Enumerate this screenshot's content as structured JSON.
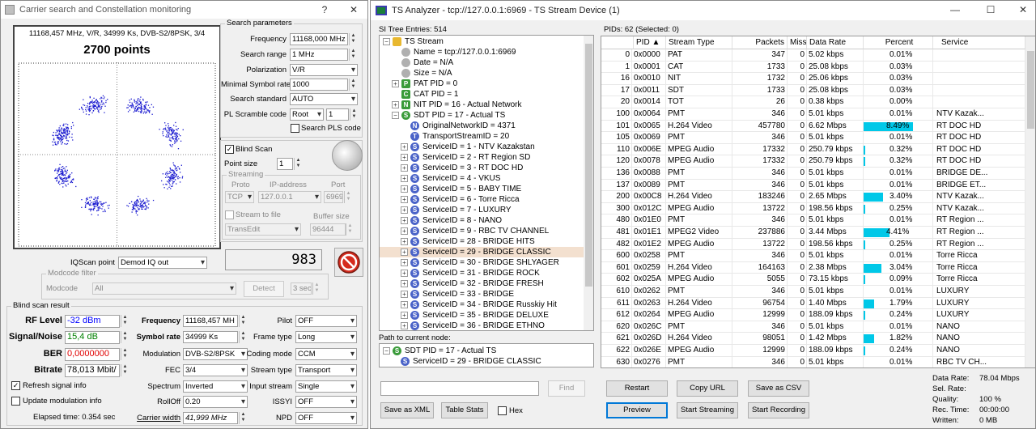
{
  "left_window": {
    "title": "Carrier search and Constellation monitoring",
    "help": "?",
    "close": "✕",
    "constellation": {
      "header": "11168,457 MHz, V/R, 34999 Ks, DVB-S2/8PSK, 3/4",
      "points_label": "2700 points"
    },
    "search_params": {
      "title": "Search parameters",
      "frequency_label": "Frequency",
      "frequency": "11168,000 MHz",
      "search_range_label": "Search range",
      "search_range": "1 MHz",
      "polarization_label": "Polarization",
      "polarization": "V/R",
      "min_sr_label": "Minimal Symbol rate",
      "min_sr": "1000",
      "standard_label": "Search standard",
      "standard": "AUTO",
      "pls_label": "PL Scramble code",
      "pls_mode": "Root",
      "pls_value": "1",
      "search_pls_label": "Search PLS code"
    },
    "blind": {
      "blind_scan_label": "Blind Scan",
      "point_size_label": "Point size",
      "point_size": "1"
    },
    "streaming": {
      "title": "Streaming",
      "proto_label": "Proto",
      "proto": "TCP",
      "ip_label": "IP-address",
      "ip": "127.0.0.1",
      "port_label": "Port",
      "port": "6969",
      "stream_to_file_label": "Stream to file",
      "buffer_label": "Buffer size",
      "file": "TransEdit",
      "buffer": "96444"
    },
    "counter": "983",
    "iqscan_label": "IQScan point",
    "iqscan": "Demod IQ out",
    "modcode_filter": {
      "title": "Modcode filter",
      "modcode_label": "Modcode",
      "modcode": "All",
      "detect": "Detect",
      "interval": "3 sec"
    },
    "result": {
      "title": "Blind scan result",
      "rf_label": "RF Level",
      "rf": "-32 dBm",
      "sn_label": "Signal/Noise",
      "sn": "15,4 dB",
      "ber_label": "BER",
      "ber": "0,0000000",
      "bitrate_label": "Bitrate",
      "bitrate": "78,013 Mbit/",
      "freq_label": "Frequency",
      "freq": "11168,457 MH",
      "sr_label": "Symbol rate",
      "sr": "34999 Ks",
      "mod_label": "Modulation",
      "mod": "DVB-S2/8PSK",
      "fec_label": "FEC",
      "fec": "3/4",
      "spectrum_label": "Spectrum",
      "spectrum": "Inverted",
      "rolloff_label": "RollOff",
      "rolloff": "0.20",
      "cw_label": "Carrier width",
      "cw": "41,999 MHz",
      "pilot_label": "Pilot",
      "pilot": "OFF",
      "frame_label": "Frame type",
      "frame": "Long",
      "coding_label": "Coding mode",
      "coding": "CCM",
      "stype_label": "Stream type",
      "stype": "Transport",
      "input_label": "Input stream",
      "input": "Single",
      "issyi_label": "ISSYI",
      "issyi": "OFF",
      "npd_label": "NPD",
      "npd": "OFF",
      "refresh_label": "Refresh signal info",
      "update_label": "Update modulation info",
      "elapsed": "Elapsed time: 0.354 sec"
    }
  },
  "ts_window": {
    "title": "TS Analyzer - tcp://127.0.0.1:6969 - TS Stream Device (1)",
    "min": "—",
    "max": "☐",
    "close": "✕",
    "tree_header": "SI Tree Entries: 514",
    "tree": [
      {
        "text": "TS Stream",
        "lvl": 0,
        "ico": "folder",
        "exp": "−"
      },
      {
        "text": "Name = tcp://127.0.0.1:6969",
        "lvl": 1,
        "ico": "dot"
      },
      {
        "text": "Date = N/A",
        "lvl": 1,
        "ico": "dot"
      },
      {
        "text": "Size = N/A",
        "lvl": 1,
        "ico": "dot"
      },
      {
        "text": "PAT PID = 0",
        "lvl": 1,
        "ico": "P",
        "exp": "+"
      },
      {
        "text": "CAT PID = 1",
        "lvl": 1,
        "ico": "C"
      },
      {
        "text": "NIT PID = 16 - Actual Network",
        "lvl": 1,
        "ico": "N",
        "exp": "+"
      },
      {
        "text": "SDT PID = 17 - Actual TS",
        "lvl": 1,
        "ico": "S",
        "exp": "−"
      },
      {
        "text": "OriginalNetworkID = 4371",
        "lvl": 2,
        "ico": "N2"
      },
      {
        "text": "TransportStreamID = 20",
        "lvl": 2,
        "ico": "T"
      },
      {
        "text": "ServiceID = 1 - NTV Kazakstan",
        "lvl": 2,
        "ico": "S2",
        "exp": "+"
      },
      {
        "text": "ServiceID = 2 - RT Region SD",
        "lvl": 2,
        "ico": "S2",
        "exp": "+"
      },
      {
        "text": "ServiceID = 3 - RT DOC HD",
        "lvl": 2,
        "ico": "S2",
        "exp": "+"
      },
      {
        "text": "ServiceID = 4 - VKUS",
        "lvl": 2,
        "ico": "S2",
        "exp": "+"
      },
      {
        "text": "ServiceID = 5 - BABY TIME",
        "lvl": 2,
        "ico": "S2",
        "exp": "+"
      },
      {
        "text": "ServiceID = 6 - Torre Ricca",
        "lvl": 2,
        "ico": "S2",
        "exp": "+"
      },
      {
        "text": "ServiceID = 7 - LUXURY",
        "lvl": 2,
        "ico": "S2",
        "exp": "+"
      },
      {
        "text": "ServiceID = 8 - NANO",
        "lvl": 2,
        "ico": "S2",
        "exp": "+"
      },
      {
        "text": "ServiceID = 9 - RBC TV CHANNEL",
        "lvl": 2,
        "ico": "S2",
        "exp": "+"
      },
      {
        "text": "ServiceID = 28 - BRIDGE HITS",
        "lvl": 2,
        "ico": "S2",
        "exp": "+"
      },
      {
        "text": "ServiceID = 29 - BRIDGE CLASSIC",
        "lvl": 2,
        "ico": "S2",
        "exp": "+",
        "sel": true
      },
      {
        "text": "ServiceID = 30 - BRIDGE SHLYAGER",
        "lvl": 2,
        "ico": "S2",
        "exp": "+"
      },
      {
        "text": "ServiceID = 31 - BRIDGE ROCK",
        "lvl": 2,
        "ico": "S2",
        "exp": "+"
      },
      {
        "text": "ServiceID = 32 - BRIDGE FRESH",
        "lvl": 2,
        "ico": "S2",
        "exp": "+"
      },
      {
        "text": "ServiceID = 33 - BRIDGE",
        "lvl": 2,
        "ico": "S2",
        "exp": "+"
      },
      {
        "text": "ServiceID = 34 - BRIDGE Russkiy Hit",
        "lvl": 2,
        "ico": "S2",
        "exp": "+"
      },
      {
        "text": "ServiceID = 35 - BRIDGE DELUXE",
        "lvl": 2,
        "ico": "S2",
        "exp": "+"
      },
      {
        "text": "ServiceID = 36 - BRIDGE ETHNO",
        "lvl": 2,
        "ico": "S2",
        "exp": "+"
      }
    ],
    "path_label": "Path to current node:",
    "path": [
      "SDT PID = 17 - Actual TS",
      "ServiceID = 29 - BRIDGE CLASSIC"
    ],
    "find": "Find",
    "save_xml": "Save as XML",
    "table_stats": "Table Stats",
    "hex": "Hex",
    "pids_header": "PIDs: 62  (Selected: 0)",
    "columns": [
      "PID",
      "Stream Type",
      "Packets",
      "Missi...",
      "Data Rate",
      "Percent",
      "Service"
    ],
    "rows": [
      [
        "0",
        "0x0000",
        "PAT",
        "347",
        "0",
        "5.02 kbps",
        "0.01%",
        "",
        0
      ],
      [
        "1",
        "0x0001",
        "CAT",
        "1733",
        "0",
        "25.08 kbps",
        "0.03%",
        "",
        0
      ],
      [
        "16",
        "0x0010",
        "NIT",
        "1732",
        "0",
        "25.06 kbps",
        "0.03%",
        "",
        0
      ],
      [
        "17",
        "0x0011",
        "SDT",
        "1733",
        "0",
        "25.08 kbps",
        "0.03%",
        "",
        0
      ],
      [
        "20",
        "0x0014",
        "TOT",
        "26",
        "0",
        "0.38 kbps",
        "0.00%",
        "",
        0
      ],
      [
        "100",
        "0x0064",
        "PMT",
        "346",
        "0",
        "5.01 kbps",
        "0.01%",
        "NTV Kazak...",
        0
      ],
      [
        "101",
        "0x0065",
        "H.264 Video",
        "457780",
        "0",
        "6.62 Mbps",
        "8.49%",
        "RT DOC HD",
        8.49
      ],
      [
        "105",
        "0x0069",
        "PMT",
        "346",
        "0",
        "5.01 kbps",
        "0.01%",
        "RT DOC HD",
        0
      ],
      [
        "110",
        "0x006E",
        "MPEG Audio",
        "17332",
        "0",
        "250.79 kbps",
        "0.32%",
        "RT DOC HD",
        0.32
      ],
      [
        "120",
        "0x0078",
        "MPEG Audio",
        "17332",
        "0",
        "250.79 kbps",
        "0.32%",
        "RT DOC HD",
        0.32
      ],
      [
        "136",
        "0x0088",
        "PMT",
        "346",
        "0",
        "5.01 kbps",
        "0.01%",
        "BRIDGE DE...",
        0
      ],
      [
        "137",
        "0x0089",
        "PMT",
        "346",
        "0",
        "5.01 kbps",
        "0.01%",
        "BRIDGE ET...",
        0
      ],
      [
        "200",
        "0x00C8",
        "H.264 Video",
        "183246",
        "0",
        "2.65 Mbps",
        "3.40%",
        "NTV Kazak...",
        3.4
      ],
      [
        "300",
        "0x012C",
        "MPEG Audio",
        "13722",
        "0",
        "198.56 kbps",
        "0.25%",
        "NTV Kazak...",
        0.25
      ],
      [
        "480",
        "0x01E0",
        "PMT",
        "346",
        "0",
        "5.01 kbps",
        "0.01%",
        "RT Region ...",
        0
      ],
      [
        "481",
        "0x01E1",
        "MPEG2 Video",
        "237886",
        "0",
        "3.44 Mbps",
        "4.41%",
        "RT Region ...",
        4.41
      ],
      [
        "482",
        "0x01E2",
        "MPEG Audio",
        "13722",
        "0",
        "198.56 kbps",
        "0.25%",
        "RT Region ...",
        0.25
      ],
      [
        "600",
        "0x0258",
        "PMT",
        "346",
        "0",
        "5.01 kbps",
        "0.01%",
        "Torre Ricca",
        0
      ],
      [
        "601",
        "0x0259",
        "H.264 Video",
        "164163",
        "0",
        "2.38 Mbps",
        "3.04%",
        "Torre Ricca",
        3.04
      ],
      [
        "602",
        "0x025A",
        "MPEG Audio",
        "5055",
        "0",
        "73.15 kbps",
        "0.09%",
        "Torre Ricca",
        0.09
      ],
      [
        "610",
        "0x0262",
        "PMT",
        "346",
        "0",
        "5.01 kbps",
        "0.01%",
        "LUXURY",
        0
      ],
      [
        "611",
        "0x0263",
        "H.264 Video",
        "96754",
        "0",
        "1.40 Mbps",
        "1.79%",
        "LUXURY",
        1.79
      ],
      [
        "612",
        "0x0264",
        "MPEG Audio",
        "12999",
        "0",
        "188.09 kbps",
        "0.24%",
        "LUXURY",
        0.24
      ],
      [
        "620",
        "0x026C",
        "PMT",
        "346",
        "0",
        "5.01 kbps",
        "0.01%",
        "NANO",
        0
      ],
      [
        "621",
        "0x026D",
        "H.264 Video",
        "98051",
        "0",
        "1.42 Mbps",
        "1.82%",
        "NANO",
        1.82
      ],
      [
        "622",
        "0x026E",
        "MPEG Audio",
        "12999",
        "0",
        "188.09 kbps",
        "0.24%",
        "NANO",
        0.24
      ],
      [
        "630",
        "0x0276",
        "PMT",
        "346",
        "0",
        "5.01 kbps",
        "0.01%",
        "RBC TV CH...",
        0
      ]
    ],
    "buttons": {
      "restart": "Restart",
      "copy_url": "Copy URL",
      "save_csv": "Save as CSV",
      "preview": "Preview",
      "start_streaming": "Start Streaming",
      "start_recording": "Start Recording"
    },
    "stats": [
      [
        "Data Rate:",
        "78.04 Mbps"
      ],
      [
        "Sel. Rate:",
        ""
      ],
      [
        "Quality:",
        "100 %"
      ],
      [
        "Rec. Time:",
        "00:00:00"
      ],
      [
        "Written:",
        "0 MB"
      ]
    ]
  },
  "colors": {
    "accent": "#0078d7",
    "percent_bar": "#00c8e8",
    "rf_blue": "#0000ff",
    "sn_green": "#008000",
    "ber_red": "#e00000",
    "stop_red": "#d52b1e",
    "tree_sel": "#f3e0cf"
  }
}
